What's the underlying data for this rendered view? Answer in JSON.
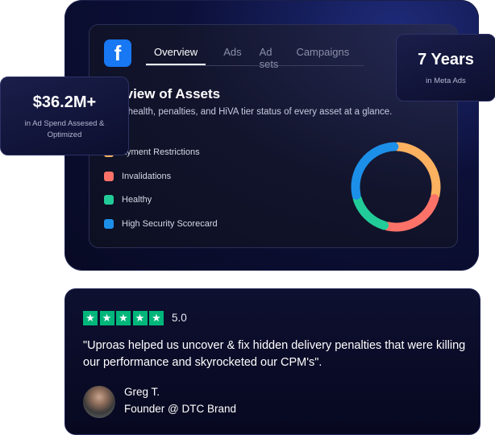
{
  "dashboard": {
    "tabs": [
      {
        "label": "Overview",
        "active": true
      },
      {
        "label": "Ads",
        "active": false
      },
      {
        "label": "Ad sets",
        "active": false
      },
      {
        "label": "Campaigns",
        "active": false
      }
    ],
    "title": "rview of Assets",
    "subtitle": "e health, penalties, and HiVA tier status of every asset at a glance.",
    "legend": [
      {
        "label": "ayment Restrictions",
        "color": "#fbb15f"
      },
      {
        "label": "Invalidations",
        "color": "#fd7268"
      },
      {
        "label": "Healthy",
        "color": "#22cc99"
      },
      {
        "label": "High Security Scorecard",
        "color": "#1c8fe8"
      }
    ]
  },
  "chart_data": {
    "type": "pie",
    "categories": [
      "Payment Restrictions",
      "Invalidations",
      "Healthy",
      "High Security Scorecard"
    ],
    "values": [
      29,
      25,
      17,
      29
    ],
    "colors": [
      "#fbb15f",
      "#fd7268",
      "#22cc99",
      "#1c8fe8"
    ]
  },
  "stats": {
    "ad_spend": {
      "value": "$36.2M+",
      "caption": "in Ad Spend Assesed & Optimized"
    },
    "experience": {
      "value": "7 Years",
      "caption": "in Meta Ads"
    }
  },
  "review": {
    "stars": 5,
    "rating": "5.0",
    "quote": "\"Uproas helped us uncover & fix hidden delivery penalties that were killing our performance and skyrocketed our CPM's\".",
    "author_name": "Greg T.",
    "author_role": "Founder @ DTC Brand"
  }
}
